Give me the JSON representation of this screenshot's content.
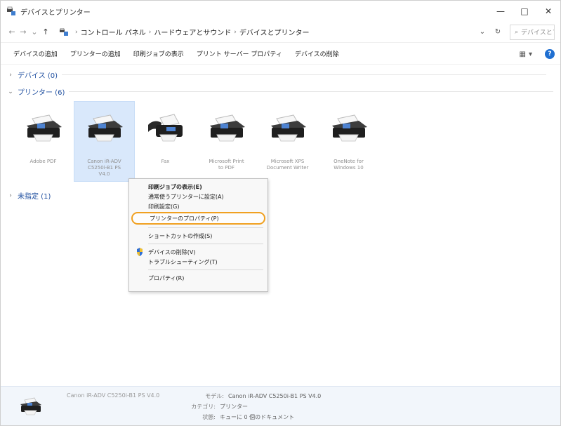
{
  "window": {
    "title": "デバイスとプリンター",
    "controls": {
      "minimize": "—",
      "maximize": "□",
      "close": "✕"
    }
  },
  "address": {
    "back": "←",
    "forward": "→",
    "up": "↑",
    "breadcrumbs": [
      "コントロール パネル",
      "ハードウェアとサウンド",
      "デバイスとプリンター"
    ],
    "search_placeholder": "デバイスとプ..."
  },
  "toolbar": {
    "items": [
      "デバイスの追加",
      "プリンターの追加",
      "印刷ジョブの表示",
      "プリント サーバー プロパティ",
      "デバイスの削除"
    ]
  },
  "groups": {
    "devices": "デバイス (0)",
    "printers": "プリンター (6)",
    "unspecified": "未指定 (1)"
  },
  "printers": [
    {
      "label": "Adobe PDF"
    },
    {
      "label": "Canon iR-ADV\nC5250i-B1 PS\nV4.0"
    },
    {
      "label": "Fax"
    },
    {
      "label": "Microsoft Print\nto PDF"
    },
    {
      "label": "Microsoft XPS\nDocument Writer"
    },
    {
      "label": "OneNote for\nWindows 10"
    }
  ],
  "context_menu": {
    "items": [
      "印刷ジョブの表示(E)",
      "通常使うプリンターに設定(A)",
      "印刷設定(G)",
      "プリンターのプロパティ(P)",
      "ショートカットの作成(S)",
      "デバイスの削除(V)",
      "トラブルシューティング(T)",
      "プロパティ(R)"
    ]
  },
  "status_pane": {
    "device_name": "Canon iR-ADV C5250i-B1 PS V4.0",
    "model_label": "モデル:",
    "model_value": "Canon iR-ADV C5250i-B1 PS V4.0",
    "category_label": "カテゴリ:",
    "category_value": "プリンター",
    "state_label": "状態:",
    "state_value": "キューに 0 個のドキュメント"
  },
  "colors": {
    "accent": "#1f6fd1",
    "selection": "#d9e8fb",
    "highlight_outline": "#f0a020"
  }
}
